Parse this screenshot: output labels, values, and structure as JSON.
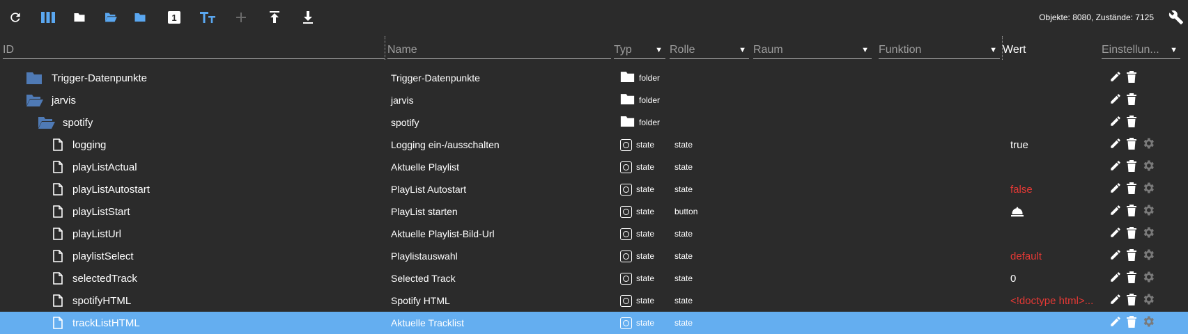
{
  "toolbar": {
    "buttons": [
      {
        "name": "refresh-icon",
        "label": "Aktualisieren"
      },
      {
        "name": "columns-icon",
        "label": "Spalten"
      },
      {
        "name": "folder-closed-icon",
        "label": "Ordner schließen"
      },
      {
        "name": "folder-open-icon",
        "label": "Ordner öffnen"
      },
      {
        "name": "folder-icon",
        "label": "Ordner"
      },
      {
        "name": "number-one-icon",
        "label": "1"
      },
      {
        "name": "text-size-icon",
        "label": "Tt"
      },
      {
        "name": "add-icon",
        "label": "+"
      },
      {
        "name": "upload-icon",
        "label": "Upload"
      },
      {
        "name": "download-icon",
        "label": "Download"
      }
    ],
    "stats": "Objekte: 8080, Zustände: 7125"
  },
  "header": {
    "id": "ID",
    "name": "Name",
    "typ": "Typ",
    "rolle": "Rolle",
    "raum": "Raum",
    "funktion": "Funktion",
    "wert": "Wert",
    "einstellungen": "Einstellun..."
  },
  "rows": [
    {
      "id": "Trigger-Datenpunkte",
      "name": "Trigger-Datenpunkte",
      "typ": "folder",
      "rolle": "",
      "wert": "",
      "level": 0,
      "icon": "folder-closed"
    },
    {
      "id": "jarvis",
      "name": "jarvis",
      "typ": "folder",
      "rolle": "",
      "wert": "",
      "level": 0,
      "icon": "folder-open"
    },
    {
      "id": "spotify",
      "name": "spotify",
      "typ": "folder",
      "rolle": "",
      "wert": "",
      "level": 1,
      "icon": "folder-open"
    },
    {
      "id": "logging",
      "name": "Logging ein-/ausschalten",
      "typ": "state",
      "rolle": "state",
      "wert": "true",
      "level": 2,
      "icon": "file"
    },
    {
      "id": "playListActual",
      "name": "Aktuelle Playlist",
      "typ": "state",
      "rolle": "state",
      "wert": "",
      "level": 2,
      "icon": "file"
    },
    {
      "id": "playListAutostart",
      "name": "PlayList Autostart",
      "typ": "state",
      "rolle": "state",
      "wert": "false",
      "level": 2,
      "icon": "file"
    },
    {
      "id": "playListStart",
      "name": "PlayList starten",
      "typ": "state",
      "rolle": "button",
      "wert": "bell",
      "level": 2,
      "icon": "file"
    },
    {
      "id": "playListUrl",
      "name": "Aktuelle Playlist-Bild-Url",
      "typ": "state",
      "rolle": "state",
      "wert": "",
      "level": 2,
      "icon": "file"
    },
    {
      "id": "playlistSelect",
      "name": "Playlistauswahl",
      "typ": "state",
      "rolle": "state",
      "wert": "default",
      "level": 2,
      "icon": "file"
    },
    {
      "id": "selectedTrack",
      "name": "Selected Track",
      "typ": "state",
      "rolle": "state",
      "wert": "0",
      "level": 2,
      "icon": "file"
    },
    {
      "id": "spotifyHTML",
      "name": "Spotify HTML",
      "typ": "state",
      "rolle": "state",
      "wert": "<!doctype html>...",
      "level": 2,
      "icon": "file"
    },
    {
      "id": "trackListHTML",
      "name": "Aktuelle Tracklist",
      "typ": "state",
      "rolle": "state",
      "wert": "",
      "level": 2,
      "icon": "file",
      "selected": true
    }
  ],
  "colors": {
    "background": "#2b2b2b",
    "accent_blue": "#64aef0",
    "folder_blue": "#4f7ab5",
    "red_value": "#e53935",
    "selected_row": "#64aef0"
  }
}
